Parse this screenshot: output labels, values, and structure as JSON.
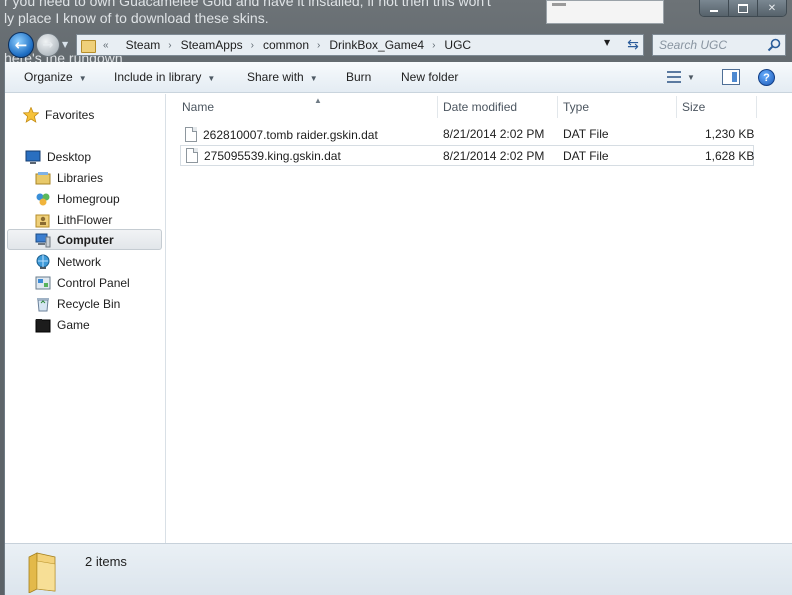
{
  "background": {
    "lines": [
      "r you need to own Guacamelee Gold and have it installed, if not then this won't",
      "ly place I know of to download these skins.",
      "here's the rundown"
    ]
  },
  "address": {
    "overflow": "«",
    "crumbs": [
      "Steam",
      "SteamApps",
      "common",
      "DrinkBox_Game4",
      "UGC"
    ],
    "search_placeholder": "Search UGC"
  },
  "toolbar": {
    "organize": "Organize",
    "include_in_library": "Include in library",
    "share_with": "Share with",
    "burn": "Burn",
    "new_folder": "New folder"
  },
  "nav": {
    "favorites": "Favorites",
    "desktop": "Desktop",
    "libraries": "Libraries",
    "homegroup": "Homegroup",
    "lithflower": "LithFlower",
    "computer": "Computer",
    "network": "Network",
    "control_panel": "Control Panel",
    "recycle_bin": "Recycle Bin",
    "game": "Game"
  },
  "columns": {
    "name": "Name",
    "date_modified": "Date modified",
    "type": "Type",
    "size": "Size"
  },
  "files": [
    {
      "name": "262810007.tomb raider.gskin.dat",
      "date": "8/21/2014 2:02 PM",
      "type": "DAT File",
      "size": "1,230 KB"
    },
    {
      "name": "275095539.king.gskin.dat",
      "date": "8/21/2014 2:02 PM",
      "type": "DAT File",
      "size": "1,628 KB"
    }
  ],
  "details": {
    "item_count": "2 items"
  },
  "colors": {
    "folder": "#f0cf6e",
    "accent": "#1b58b6",
    "toolbar": "#e4ecf3"
  }
}
